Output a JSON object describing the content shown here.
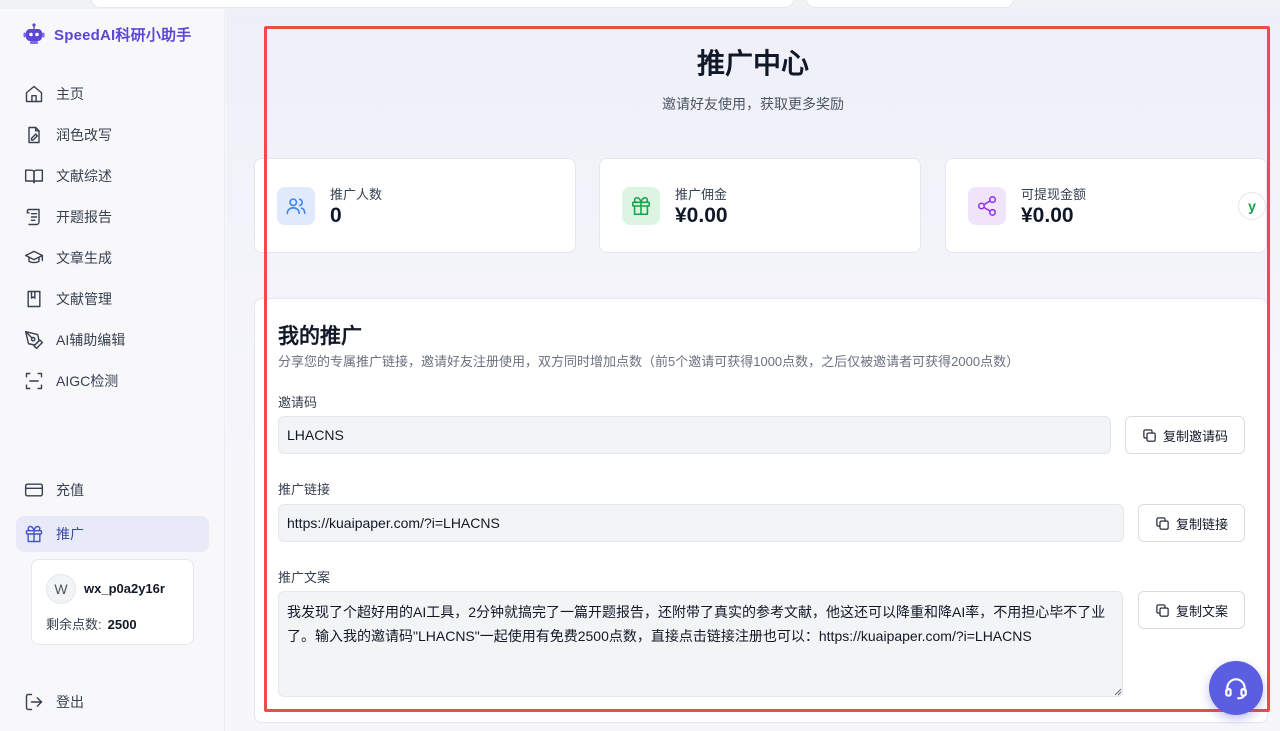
{
  "app": {
    "name": "SpeedAI科研小助手"
  },
  "sidebar": {
    "items": [
      {
        "label": "主页",
        "icon": "home-icon"
      },
      {
        "label": "润色改写",
        "icon": "edit-file-icon"
      },
      {
        "label": "文献综述",
        "icon": "open-book-icon"
      },
      {
        "label": "开题报告",
        "icon": "scroll-icon"
      },
      {
        "label": "文章生成",
        "icon": "graduation-cap-icon"
      },
      {
        "label": "文献管理",
        "icon": "bookmark-book-icon"
      },
      {
        "label": "AI辅助编辑",
        "icon": "pen-tool-icon"
      },
      {
        "label": "AIGC检测",
        "icon": "scan-icon"
      }
    ],
    "recharge": {
      "label": "充值",
      "icon": "credit-card-icon"
    },
    "promote": {
      "label": "推广",
      "icon": "gift-icon",
      "active": true
    },
    "user": {
      "avatar_letter": "W",
      "username": "wx_p0a2y16r",
      "points_label": "剩余点数:",
      "points_value": "2500"
    },
    "logout": {
      "label": "登出",
      "icon": "logout-icon"
    }
  },
  "page": {
    "title": "推广中心",
    "subtitle": "邀请好友使用，获取更多奖励"
  },
  "stats": [
    {
      "label": "推广人数",
      "value": "0",
      "icon": "users-icon",
      "color": "#3b82f6",
      "bg": "#e0eafc"
    },
    {
      "label": "推广佣金",
      "value": "¥0.00",
      "icon": "gift-icon",
      "color": "#16a34a",
      "bg": "#dcf5e3"
    },
    {
      "label": "可提现金额",
      "value": "¥0.00",
      "icon": "share-icon",
      "color": "#9333ea",
      "bg": "#f0e4fb"
    }
  ],
  "edge_badge": {
    "text": "y"
  },
  "promo": {
    "title": "我的推广",
    "description": "分享您的专属推广链接，邀请好友注册使用，双方同时增加点数（前5个邀请可获得1000点数，之后仅被邀请者可获得2000点数）",
    "invite_code_label": "邀请码",
    "invite_code": "LHACNS",
    "copy_code_label": "复制邀请码",
    "link_label": "推广链接",
    "link": "https://kuaipaper.com/?i=LHACNS",
    "copy_link_label": "复制链接",
    "copy_text_label": "推广文案",
    "copy_text": "我发现了个超好用的AI工具，2分钟就搞完了一篇开题报告，还附带了真实的参考文献，他这还可以降重和降AI率，不用担心毕不了业了。输入我的邀请码\"LHACNS\"一起使用有免费2500点数，直接点击链接注册也可以：https://kuaipaper.com/?i=LHACNS",
    "copy_text_button_label": "复制文案"
  },
  "colors": {
    "brand": "#5b46d6",
    "highlight_border": "#ee4b4b",
    "fab": "#5b5ee0"
  }
}
